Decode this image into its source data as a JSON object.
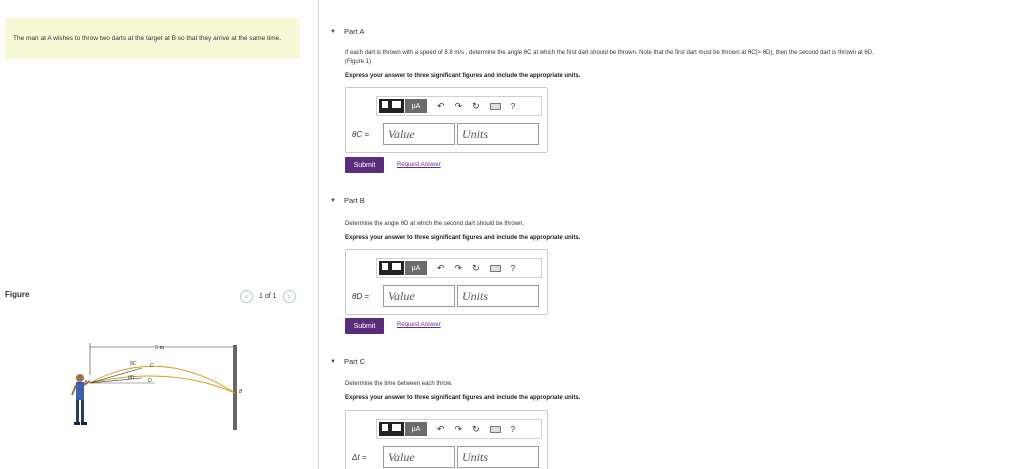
{
  "problem": {
    "text": "The man at A wishes to throw two darts at the target at B so that they arrive at the same time."
  },
  "figure": {
    "label": "Figure",
    "pager_text": "1 of 1",
    "prev_icon": "chevron-left-icon",
    "next_icon": "chevron-right-icon",
    "dimension": "5 m",
    "labels": {
      "a": "A",
      "b": "B",
      "c": "C",
      "d": "D",
      "theta_c": "θC",
      "theta_d": "θD"
    }
  },
  "toolbar": {
    "templates_icon": "templates-icon",
    "mu_label": "μA",
    "undo_icon": "undo-icon",
    "redo_icon": "redo-icon",
    "reset_icon": "reset-icon",
    "keyboard_icon": "keyboard-icon",
    "help_label": "?"
  },
  "parts": [
    {
      "header": "Part A",
      "question": "If each dart is thrown with a speed of 8.8 m/s , determine the angle θC at which the first dart should be thrown. Note that the first dart must be thrown at θC(> θD), then the second dart is thrown at θD.",
      "figure_link": "(Figure 1)",
      "instruction": "Express your answer to three significant figures and include the appropriate units.",
      "var_label": "θC =",
      "value_placeholder": "Value",
      "units_placeholder": "Units",
      "submit": "Submit",
      "request": "Request Answer"
    },
    {
      "header": "Part B",
      "question": "Determine the angle θD at which the second dart should be thrown.",
      "instruction": "Express your answer to three significant figures and include the appropriate units.",
      "var_label": "θD =",
      "value_placeholder": "Value",
      "units_placeholder": "Units",
      "submit": "Submit",
      "request": "Request Answer"
    },
    {
      "header": "Part C",
      "question": "Determine the time between each throw.",
      "instruction": "Express your answer to three significant figures and include the appropriate units.",
      "var_label": "Δt =",
      "value_placeholder": "Value",
      "units_placeholder": "Units"
    }
  ]
}
